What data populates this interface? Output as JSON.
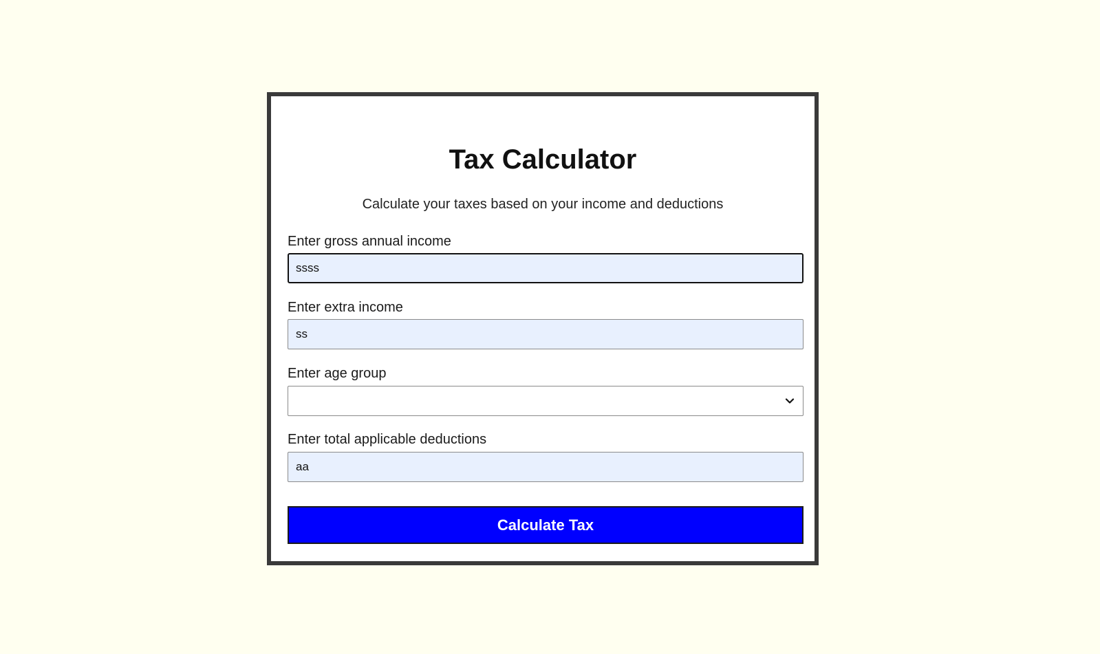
{
  "page": {
    "title": "Tax Calculator",
    "subtitle": "Calculate your taxes based on your income and deductions"
  },
  "form": {
    "gross_income": {
      "label": "Enter gross annual income",
      "value": "ssss"
    },
    "extra_income": {
      "label": "Enter extra income",
      "value": "ss"
    },
    "age_group": {
      "label": "Enter age group",
      "selected": ""
    },
    "deductions": {
      "label": "Enter total applicable deductions",
      "value": "aa"
    },
    "submit_label": "Calculate Tax"
  },
  "icons": {
    "select_chevron": "chevron-down-icon"
  },
  "colors": {
    "background": "#fffff0",
    "card_border": "#3a3a3a",
    "input_fill": "#e8f0fe",
    "button": "#0000ff",
    "button_text": "#ffffff"
  }
}
